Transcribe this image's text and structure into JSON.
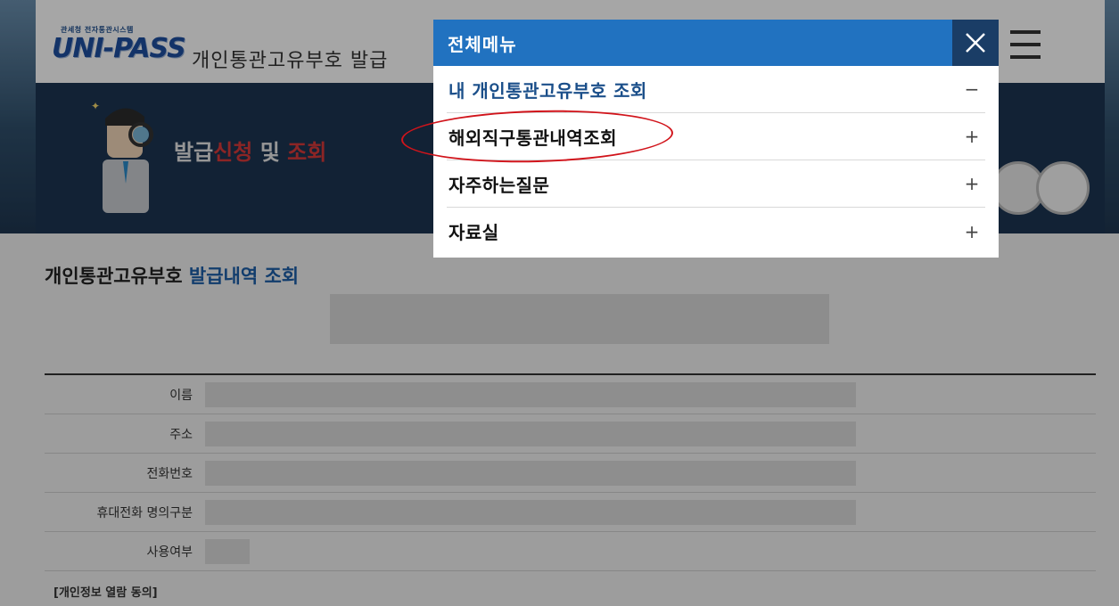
{
  "header": {
    "logo_sub": "관세청 전자통관시스템",
    "logo_main": "UNI-PASS",
    "title": "개인통관고유부호 발급"
  },
  "banner": {
    "title_prefix": "발급",
    "title_red1": "신청",
    "title_mid": " 및 ",
    "title_red2": "조회"
  },
  "content": {
    "title_prefix": "개인통관고유부호 ",
    "title_blue": "발급내역 조회",
    "rows": [
      {
        "label": "이름"
      },
      {
        "label": "주소"
      },
      {
        "label": "전화번호"
      },
      {
        "label": "휴대전화 명의구분"
      },
      {
        "label": "사용여부"
      }
    ],
    "consent": "[개인정보 열람 동의]"
  },
  "menu": {
    "title": "전체메뉴",
    "items": [
      {
        "label": "내 개인통관고유부호 조회",
        "toggle": "−",
        "active": true
      },
      {
        "label": "해외직구통관내역조회",
        "toggle": "+",
        "active": false
      },
      {
        "label": "자주하는질문",
        "toggle": "+",
        "active": false
      },
      {
        "label": "자료실",
        "toggle": "+",
        "active": false
      }
    ]
  },
  "colors": {
    "menu_header": "#2172c0",
    "menu_close": "#1a3d66",
    "active_item": "#1b4f8a",
    "annotation": "#d1141b",
    "banner": "#1c3552"
  },
  "icons": [
    "close-icon",
    "hamburger-menu-icon",
    "plus-icon",
    "minus-icon"
  ]
}
